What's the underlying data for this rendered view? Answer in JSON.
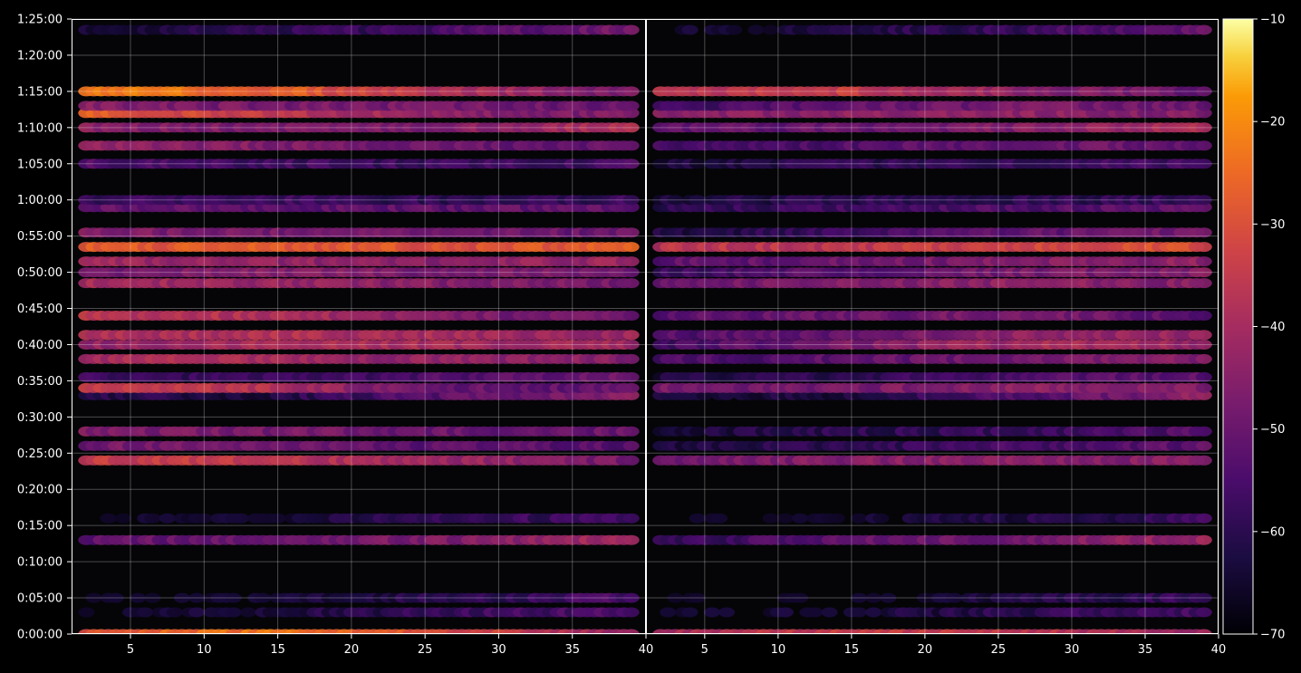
{
  "chart_data": {
    "type": "heatmap",
    "title": "",
    "xlabel": "",
    "ylabel": "",
    "grid": true,
    "panels": [
      {
        "name": "",
        "xlim": [
          1,
          40
        ],
        "xticks": [
          5,
          10,
          15,
          20,
          25,
          30,
          35,
          40
        ]
      },
      {
        "name": "",
        "xlim": [
          1,
          40
        ],
        "xticks": [
          5,
          10,
          15,
          20,
          25,
          30,
          35,
          40
        ]
      }
    ],
    "y": {
      "unit": "seconds",
      "lim": [
        0,
        5100
      ],
      "ticks": [
        0,
        300,
        600,
        900,
        1200,
        1500,
        1800,
        2100,
        2400,
        2700,
        3000,
        3300,
        3600,
        3900,
        4200,
        4500,
        4800,
        5100
      ],
      "tick_labels": [
        "0:00:00",
        "0:05:00",
        "0:10:00",
        "0:15:00",
        "0:20:00",
        "0:25:00",
        "0:30:00",
        "0:35:00",
        "0:40:00",
        "0:45:00",
        "0:50:00",
        "0:55:00",
        "1:00:00",
        "1:05:00",
        "1:10:00",
        "1:15:00",
        "1:20:00",
        "1:25:00"
      ]
    },
    "colorbar": {
      "colormap": "inferno",
      "range": [
        -70,
        -10
      ],
      "ticks": [
        -10,
        -20,
        -30,
        -40,
        -50,
        -60,
        -70
      ],
      "tick_labels": [
        "−10",
        "−20",
        "−30",
        "−40",
        "−50",
        "−60",
        "−70"
      ]
    },
    "bands": [
      {
        "t": 0,
        "left": [
          -28,
          -24,
          -30,
          -44
        ],
        "right": [
          -40,
          -35,
          -36,
          -42
        ]
      },
      {
        "t": 180,
        "left": [
          -66,
          -64,
          -58,
          -55
        ],
        "right": [
          -66,
          -64,
          -60,
          -56
        ]
      },
      {
        "t": 300,
        "left": [
          -68,
          -66,
          -60,
          -55
        ],
        "right": [
          -69,
          -68,
          -62,
          -58
        ]
      },
      {
        "t": 780,
        "left": [
          -52,
          -48,
          -47,
          -40
        ],
        "right": [
          -60,
          -52,
          -48,
          -42
        ]
      },
      {
        "t": 960,
        "left": [
          -68,
          -64,
          -60,
          -55
        ],
        "right": [
          -69,
          -66,
          -62,
          -58
        ]
      },
      {
        "t": 1440,
        "left": [
          -34,
          -36,
          -42,
          -48
        ],
        "right": [
          -48,
          -46,
          -44,
          -46
        ]
      },
      {
        "t": 1560,
        "left": [
          -48,
          -50,
          -52,
          -54
        ],
        "right": [
          -62,
          -60,
          -56,
          -52
        ]
      },
      {
        "t": 1680,
        "left": [
          -46,
          -48,
          -50,
          -50
        ],
        "right": [
          -64,
          -60,
          -58,
          -54
        ]
      },
      {
        "t": 1980,
        "left": [
          -60,
          -62,
          -52,
          -44
        ],
        "right": [
          -64,
          -62,
          -54,
          -44
        ]
      },
      {
        "t": 2040,
        "left": [
          -32,
          -38,
          -50,
          -52
        ],
        "right": [
          -48,
          -48,
          -44,
          -46
        ]
      },
      {
        "t": 2130,
        "left": [
          -58,
          -58,
          -54,
          -50
        ],
        "right": [
          -62,
          -60,
          -54,
          -52
        ]
      },
      {
        "t": 2280,
        "left": [
          -40,
          -40,
          -44,
          -46
        ],
        "right": [
          -56,
          -52,
          -48,
          -46
        ]
      },
      {
        "t": 2400,
        "left": [
          -44,
          -38,
          -40,
          -42
        ],
        "right": [
          -56,
          -48,
          -40,
          -42
        ]
      },
      {
        "t": 2480,
        "left": [
          -40,
          -38,
          -40,
          -42
        ],
        "right": [
          -54,
          -50,
          -44,
          -42
        ]
      },
      {
        "t": 2640,
        "left": [
          -36,
          -38,
          -46,
          -50
        ],
        "right": [
          -52,
          -50,
          -48,
          -52
        ]
      },
      {
        "t": 2910,
        "left": [
          -40,
          -42,
          -46,
          -48
        ],
        "right": [
          -50,
          -46,
          -44,
          -46
        ]
      },
      {
        "t": 3000,
        "left": [
          -48,
          -46,
          -48,
          -48
        ],
        "right": [
          -58,
          -52,
          -48,
          -46
        ]
      },
      {
        "t": 3090,
        "left": [
          -42,
          -44,
          -44,
          -42
        ],
        "right": [
          -52,
          -50,
          -46,
          -44
        ]
      },
      {
        "t": 3210,
        "left": [
          -28,
          -28,
          -30,
          -28
        ],
        "right": [
          -36,
          -36,
          -32,
          -30
        ]
      },
      {
        "t": 3330,
        "left": [
          -46,
          -48,
          -50,
          -50
        ],
        "right": [
          -62,
          -58,
          -52,
          -48
        ]
      },
      {
        "t": 3540,
        "left": [
          -50,
          -52,
          -52,
          -50
        ],
        "right": [
          -60,
          -56,
          -54,
          -52
        ]
      },
      {
        "t": 3600,
        "left": [
          -58,
          -56,
          -60,
          -58
        ],
        "right": [
          -64,
          -60,
          -60,
          -58
        ]
      },
      {
        "t": 3900,
        "left": [
          -54,
          -56,
          -58,
          -56
        ],
        "right": [
          -64,
          -60,
          -58,
          -56
        ]
      },
      {
        "t": 4050,
        "left": [
          -44,
          -46,
          -50,
          -50
        ],
        "right": [
          -56,
          -54,
          -50,
          -50
        ]
      },
      {
        "t": 4200,
        "left": [
          -44,
          -48,
          -46,
          -38
        ],
        "right": [
          -52,
          -50,
          -46,
          -38
        ]
      },
      {
        "t": 4320,
        "left": [
          -26,
          -36,
          -44,
          -48
        ],
        "right": [
          -44,
          -44,
          -44,
          -46
        ]
      },
      {
        "t": 4380,
        "left": [
          -46,
          -48,
          -48,
          -50
        ],
        "right": [
          -58,
          -52,
          -48,
          -50
        ]
      },
      {
        "t": 4500,
        "left": [
          -22,
          -26,
          -38,
          -48
        ],
        "right": [
          -36,
          -34,
          -44,
          -50
        ]
      },
      {
        "t": 5010,
        "left": [
          -64,
          -60,
          -56,
          -48
        ],
        "right": [
          -66,
          -62,
          -58,
          -50
        ]
      }
    ]
  }
}
